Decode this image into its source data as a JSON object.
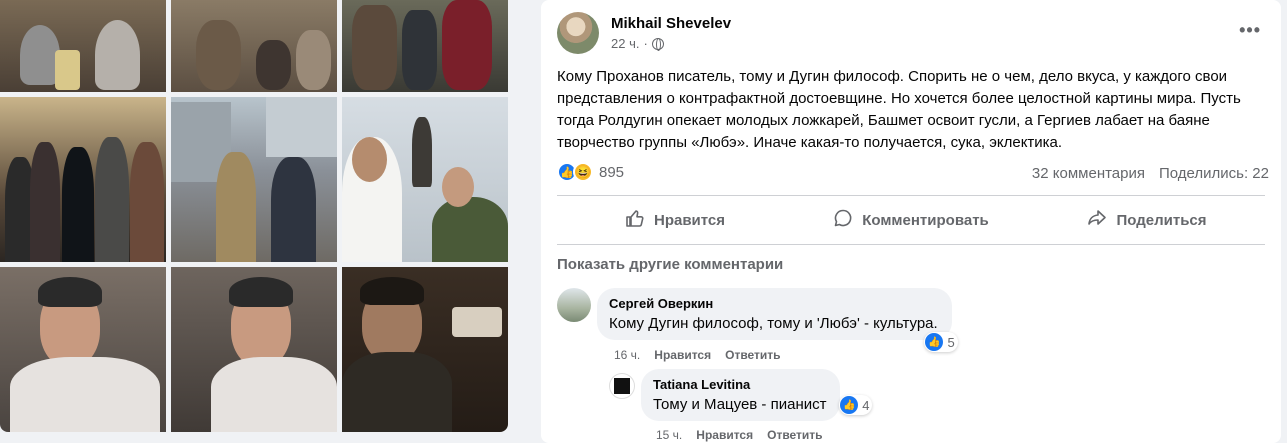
{
  "post": {
    "author": "Mikhail Shevelev",
    "time": "22 ч.",
    "more_icon": "more-options-icon",
    "text": "Кому Проханов писатель, тому и Дугин философ. Спорить не о чем, дело вкуса, у каждого свои представления о контрафактной достоевщине. Но хочется более целостной картины мира. Пусть тогда Ролдугин опекает молодых ложкарей, Башмет освоит гусли, а Гергиев лабает на баяне творчество группы «Любэ». Иначе какая-то получается, сука, эклектика.",
    "reaction_count": "895",
    "comments_count": "32 комментария",
    "shares_count": "Поделились: 22"
  },
  "actions": {
    "like": "Нравится",
    "comment": "Комментировать",
    "share": "Поделиться"
  },
  "show_more_comments": "Показать другие комментарии",
  "comments": [
    {
      "author": "Сергей Оверкин",
      "text": "Кому Дугин философ, тому и 'Любэ' - культура.",
      "time": "16 ч.",
      "like_label": "Нравится",
      "reply_label": "Ответить",
      "reactions": "5"
    },
    {
      "author": "Tatiana Levitina",
      "text": "Тому и Мацуев - пианист",
      "time": "15 ч.",
      "like_label": "Нравится",
      "reply_label": "Ответить",
      "reactions": "4"
    }
  ],
  "colors": {
    "accent": "#1877f2",
    "secondary_text": "#65676b",
    "page_bg": "#f0f2f5"
  }
}
